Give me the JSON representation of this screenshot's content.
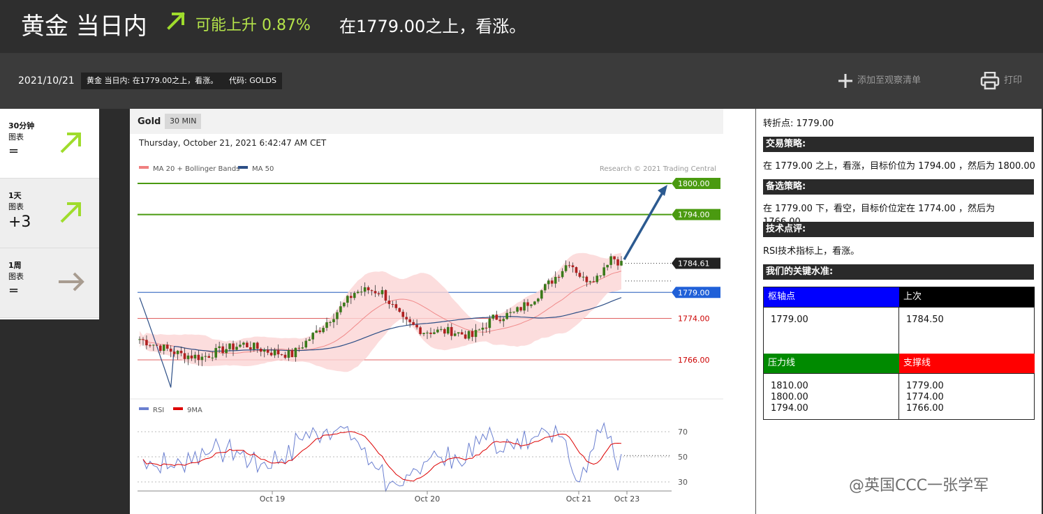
{
  "header": {
    "title": "黄金 当日内",
    "trend": "可能上升 0.87%",
    "description": "在1779.00之上，看涨。",
    "trend_color": "#b4e34a"
  },
  "subbar": {
    "date": "2021/10/21",
    "tag_summary": "黄金 当日内: 在1779.00之上，看涨。",
    "tag_code": "代码: GOLDS",
    "add_watchlist": "添加至观察清单",
    "print": "打印"
  },
  "timeframes": [
    {
      "label": "30分钟",
      "sub": "图表",
      "value": "=",
      "icon": "arrow-up-right-icon",
      "color": "#9fdc2c"
    },
    {
      "label": "1天",
      "sub": "图表",
      "value": "+3",
      "icon": "arrow-up-right-icon",
      "color": "#9fdc2c"
    },
    {
      "label": "1周",
      "sub": "图表",
      "value": "=",
      "icon": "arrow-right-icon",
      "color": "#a89c90"
    }
  ],
  "chart": {
    "name": "Gold",
    "timeframe": "30 MIN",
    "timestamp": "Thursday, October 21, 2021 6:42:47 AM CET",
    "legend_ma20": "MA 20 + Bollinger Bands",
    "legend_ma50": "MA 50",
    "credit": "Research © 2021 Trading Central",
    "rsi_legend": "RSI",
    "rsi_ma_legend": "9MA",
    "x_labels": [
      "Oct 19",
      "Oct 20",
      "Oct 21",
      "Oct 23"
    ],
    "rsi_levels": [
      "70",
      "50",
      "30"
    ],
    "price_tags": [
      {
        "label": "1800.00",
        "kind": "target",
        "color": "#4a9a10"
      },
      {
        "label": "1794.00",
        "kind": "target",
        "color": "#4a9a10"
      },
      {
        "label": "1784.61",
        "kind": "last",
        "color": "#222222"
      },
      {
        "label": "1779.00",
        "kind": "pivot",
        "color": "#2060d8"
      },
      {
        "label": "1774.00",
        "kind": "support",
        "color": "#cc0000"
      },
      {
        "label": "1766.00",
        "kind": "support",
        "color": "#cc0000"
      }
    ]
  },
  "analysis": {
    "pivot_line": "转折点: 1779.00",
    "strategy_head": "交易策略:",
    "strategy_text": "在 1779.00 之上，看涨，目标价位为 1794.00 ，然后为 1800.00 。",
    "alt_head": "备选策略:",
    "alt_text": "在 1779.00 下，看空，目标价位定在 1774.00 ，然后为 1766.00。",
    "tech_head": "技术点评:",
    "tech_text": "RSI技术指标上，看涨。",
    "levels_head": "我们的关键水准:",
    "levels": {
      "pivot_label": "枢轴点",
      "pivot_value": "1779.00",
      "last_label": "上次",
      "last_value": "1784.50",
      "resistance_label": "压力线",
      "resistance_values": [
        "1810.00",
        "1800.00",
        "1794.00"
      ],
      "support_label": "支撑线",
      "support_values": [
        "1779.00",
        "1774.00",
        "1766.00"
      ],
      "colors": {
        "pivot": "#0000ff",
        "last": "#000000",
        "resistance": "#008a00",
        "support": "#ff0000"
      }
    }
  },
  "watermark": "@英国CCC一张学军"
}
